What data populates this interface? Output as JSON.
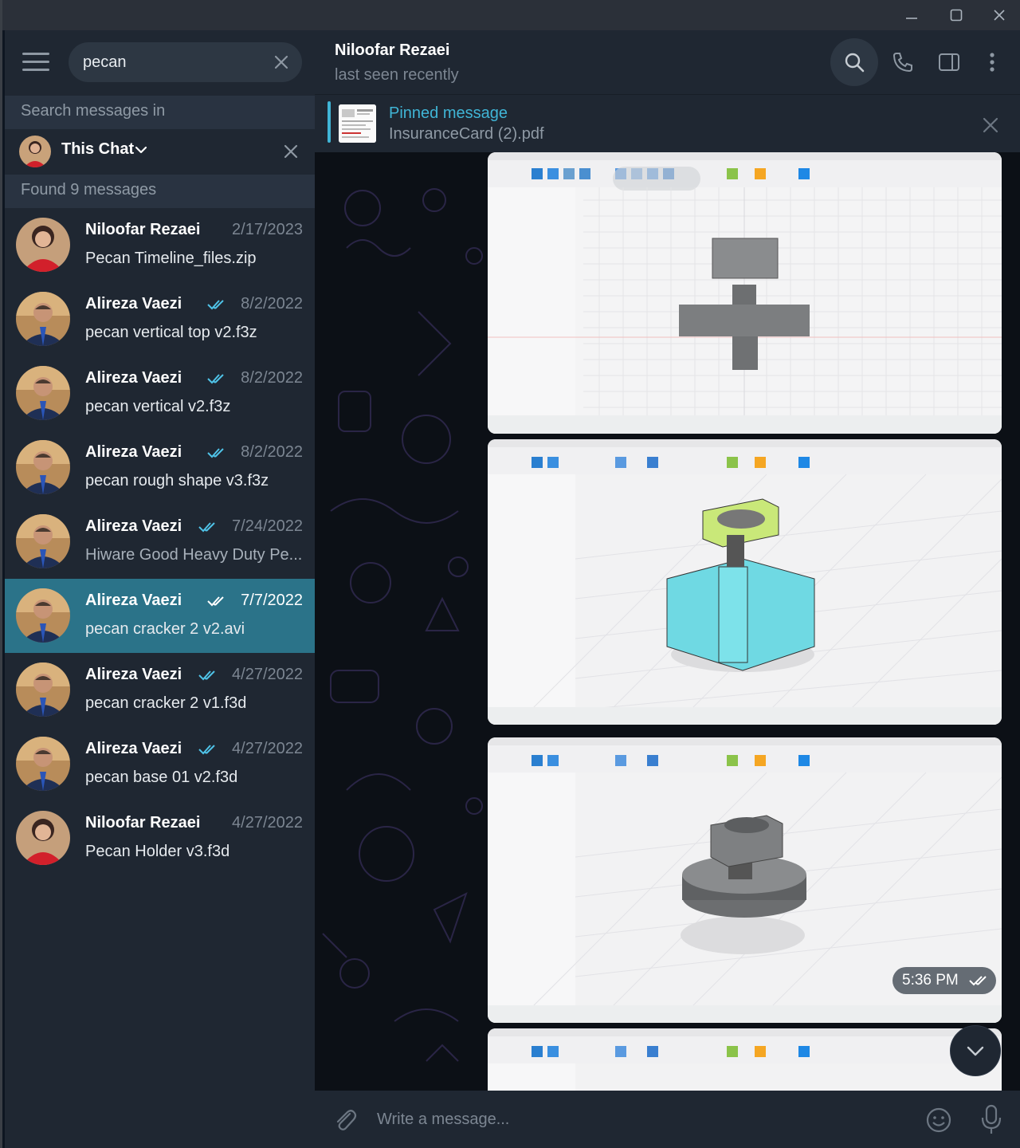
{
  "window": {
    "controls": [
      "minimize-icon",
      "maximize-icon",
      "close-icon"
    ]
  },
  "search": {
    "query": "pecan",
    "search_in_label": "Search messages in",
    "scope_label": "This Chat",
    "found_label": "Found 9 messages"
  },
  "results": [
    {
      "name": "Niloofar Rezaei",
      "date": "2/17/2023",
      "message": "Pecan Timeline_files.zip",
      "read": false,
      "avatar": "niloofar"
    },
    {
      "name": "Alireza Vaezi",
      "date": "8/2/2022",
      "message": "pecan vertical top v2.f3z",
      "read": true,
      "avatar": "alireza"
    },
    {
      "name": "Alireza Vaezi",
      "date": "8/2/2022",
      "message": "pecan vertical v2.f3z",
      "read": true,
      "avatar": "alireza"
    },
    {
      "name": "Alireza Vaezi",
      "date": "8/2/2022",
      "message": "pecan rough shape v3.f3z",
      "read": true,
      "avatar": "alireza"
    },
    {
      "name": "Alireza Vaezi",
      "date": "7/24/2022",
      "message": "Hiware Good Heavy Duty Pe...",
      "read": true,
      "avatar": "alireza"
    },
    {
      "name": "Alireza Vaezi",
      "date": "7/7/2022",
      "message": "pecan cracker 2 v2.avi",
      "read": true,
      "avatar": "alireza",
      "selected": true
    },
    {
      "name": "Alireza Vaezi",
      "date": "4/27/2022",
      "message": "pecan cracker 2 v1.f3d",
      "read": true,
      "avatar": "alireza"
    },
    {
      "name": "Alireza Vaezi",
      "date": "4/27/2022",
      "message": "pecan base 01 v2.f3d",
      "read": true,
      "avatar": "alireza"
    },
    {
      "name": "Niloofar Rezaei",
      "date": "4/27/2022",
      "message": "Pecan Holder v3.f3d",
      "read": false,
      "avatar": "niloofar"
    }
  ],
  "chat": {
    "peer_name": "Niloofar Rezaei",
    "peer_status": "last seen recently",
    "header_buttons": [
      "search-icon",
      "phone-icon",
      "sidebar-toggle-icon",
      "more-vertical-icon"
    ],
    "pinned": {
      "title": "Pinned message",
      "file": "InsuranceCard (2).pdf"
    },
    "message_time": "5:36 PM",
    "composer_placeholder": "Write a message..."
  },
  "colors": {
    "accent": "#40b5d6",
    "selected_row": "#2b7389",
    "panel": "#1f2732",
    "check": "#4fc3e8"
  }
}
